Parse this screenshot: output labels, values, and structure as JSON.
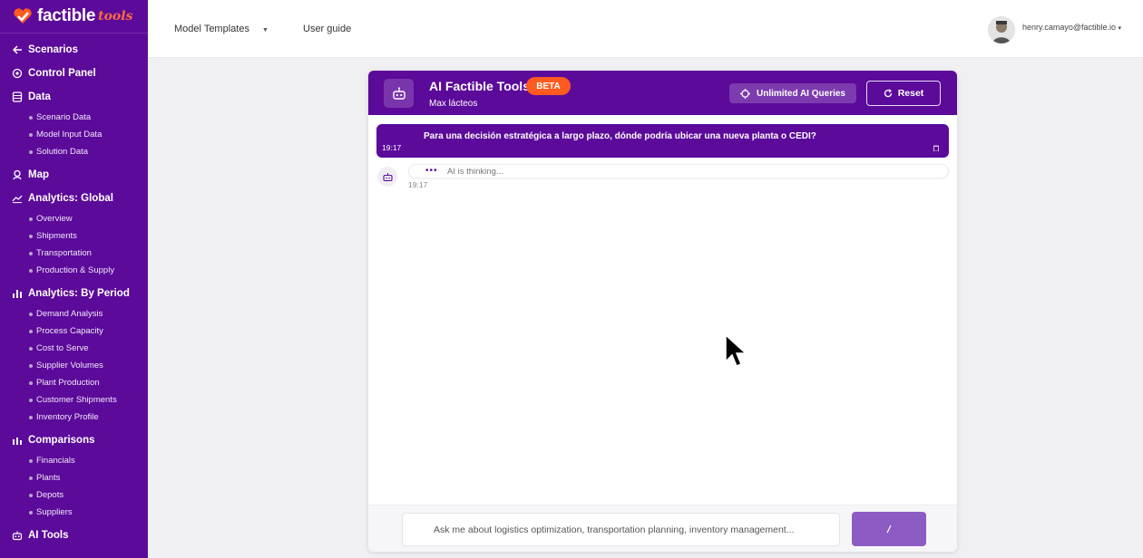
{
  "brand": {
    "name": "factible",
    "suffix": "tools"
  },
  "colors": {
    "primary": "#5c0a9a",
    "accent": "#ff5a1f",
    "send": "#8c5cc4"
  },
  "sidebar": {
    "back": {
      "label": "Scenarios",
      "icon": "arrow-left-icon"
    },
    "control_panel": {
      "label": "Control Panel",
      "icon": "gear-icon"
    },
    "data": {
      "label": "Data",
      "icon": "database-icon",
      "items": [
        "Scenario Data",
        "Model Input Data",
        "Solution Data"
      ]
    },
    "map": {
      "label": "Map",
      "icon": "map-pin-icon"
    },
    "analytics_global": {
      "label": "Analytics: Global",
      "icon": "line-chart-icon",
      "items": [
        "Overview",
        "Shipments",
        "Transportation",
        "Production & Supply"
      ]
    },
    "analytics_period": {
      "label": "Analytics: By Period",
      "icon": "bar-chart-icon",
      "items": [
        "Demand Analysis",
        "Process Capacity",
        "Cost to Serve",
        "Supplier Volumes",
        "Plant Production",
        "Customer Shipments",
        "Inventory Profile"
      ]
    },
    "comparisons": {
      "label": "Comparisons",
      "icon": "bar-chart-icon",
      "items": [
        "Financials",
        "Plants",
        "Depots",
        "Suppliers"
      ]
    },
    "ai_tools": {
      "label": "AI Tools",
      "icon": "robot-icon"
    }
  },
  "topbar": {
    "model_templates": "Model Templates",
    "user_guide": "User guide",
    "user_email": "henry.camayo@factible.io"
  },
  "chat": {
    "title": "AI Factible Tools",
    "badge": "BETA",
    "subtitle": "Max lácteos",
    "unlimited_label": "Unlimited AI Queries",
    "reset_label": "Reset",
    "user_message": {
      "text": "Para una decisión estratégica a largo plazo, dónde podría ubicar una nueva planta o CEDI?",
      "time": "19:17"
    },
    "ai_message": {
      "dots": "•••",
      "text": "AI is thinking...",
      "time": "19:17"
    },
    "input_placeholder": "Ask me about logistics optimization, transportation planning, inventory management..."
  }
}
